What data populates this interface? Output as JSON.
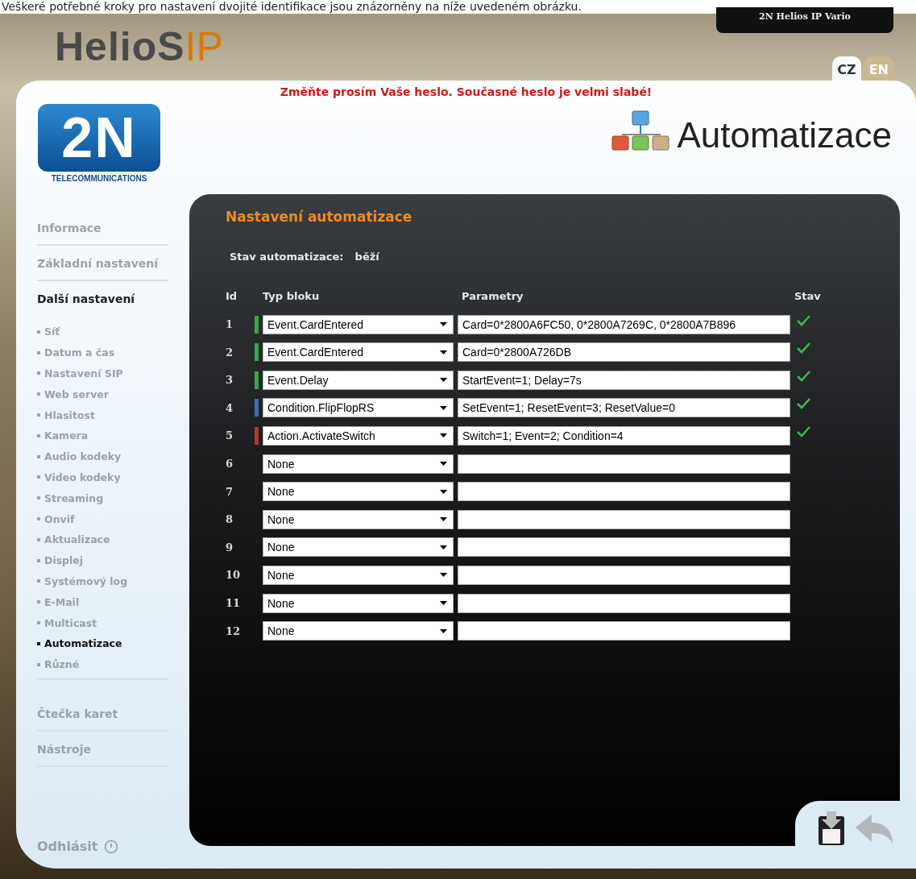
{
  "caption": "Veškeré potřebné kroky pro nastavení dvojité identifikace jsou znázorněny na níže uvedeném obrázku.",
  "header": {
    "logo_main": "HelioS",
    "logo_suffix": "IP",
    "device": "2N Helios IP Vario",
    "languages": [
      {
        "label": "CZ",
        "selected": true
      },
      {
        "label": "EN",
        "selected": false
      }
    ]
  },
  "warning": "Změňte prosím Vaše heslo. Současné heslo je velmi slabé!",
  "brand": {
    "mark": "2N",
    "tagline": "TELECOMMUNICATIONS"
  },
  "page_title": "Automatizace",
  "sidebar": {
    "items": [
      {
        "label": "Informace",
        "selected": false
      },
      {
        "label": "Základní nastavení",
        "selected": false
      },
      {
        "label": "Další nastavení",
        "selected": true,
        "children": [
          {
            "label": "Síť",
            "selected": false
          },
          {
            "label": "Datum a čas",
            "selected": false
          },
          {
            "label": "Nastavení SIP",
            "selected": false
          },
          {
            "label": "Web server",
            "selected": false
          },
          {
            "label": "Hlasitost",
            "selected": false
          },
          {
            "label": "Kamera",
            "selected": false
          },
          {
            "label": "Audio kodeky",
            "selected": false
          },
          {
            "label": "Video kodeky",
            "selected": false
          },
          {
            "label": "Streaming",
            "selected": false
          },
          {
            "label": "Onvif",
            "selected": false
          },
          {
            "label": "Aktualizace",
            "selected": false
          },
          {
            "label": "Displej",
            "selected": false
          },
          {
            "label": "Systémový log",
            "selected": false
          },
          {
            "label": "E-Mail",
            "selected": false
          },
          {
            "label": "Multicast",
            "selected": false
          },
          {
            "label": "Automatizace",
            "selected": true
          },
          {
            "label": "Různé",
            "selected": false
          }
        ]
      },
      {
        "label": "Čtečka karet",
        "selected": false
      },
      {
        "label": "Nástroje",
        "selected": false
      }
    ],
    "logout": "Odhlásit"
  },
  "panel": {
    "title": "Nastavení automatizace",
    "status_label": "Stav automatizace:",
    "status_value": "běží",
    "table": {
      "columns": [
        "Id",
        "Typ bloku",
        "Parametry",
        "Stav"
      ],
      "rows": [
        {
          "id": "1",
          "type": "Event.CardEntered",
          "params": "Card=0*2800A6FC50, 0*2800A7269C, 0*2800A7B896",
          "ok": true,
          "color": "#3aa64a"
        },
        {
          "id": "2",
          "type": "Event.CardEntered",
          "params": "Card=0*2800A726DB",
          "ok": true,
          "color": "#3aa64a"
        },
        {
          "id": "3",
          "type": "Event.Delay",
          "params": "StartEvent=1; Delay=7s",
          "ok": true,
          "color": "#3aa64a"
        },
        {
          "id": "4",
          "type": "Condition.FlipFlopRS",
          "params": "SetEvent=1; ResetEvent=3; ResetValue=0",
          "ok": true,
          "color": "#3f6fb5"
        },
        {
          "id": "5",
          "type": "Action.ActivateSwitch",
          "params": "Switch=1; Event=2; Condition=4",
          "ok": true,
          "color": "#b03a30"
        },
        {
          "id": "6",
          "type": "None",
          "ok": false
        },
        {
          "id": "7",
          "type": "None",
          "ok": false
        },
        {
          "id": "8",
          "type": "None",
          "ok": false
        },
        {
          "id": "9",
          "type": "None",
          "ok": false
        },
        {
          "id": "10",
          "type": "None",
          "ok": false
        },
        {
          "id": "11",
          "type": "None",
          "ok": false
        },
        {
          "id": "12",
          "type": "None",
          "ok": false
        }
      ]
    }
  }
}
